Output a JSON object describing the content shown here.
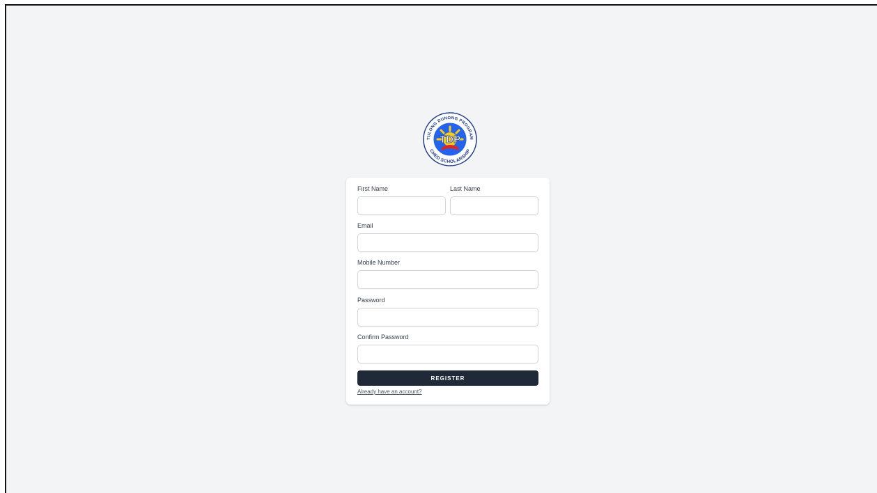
{
  "logo": {
    "text": "TDP",
    "ring_top": "TULONG DUNONG PROGRAM",
    "ring_bottom": "CHED SCHOLARSHIP",
    "colors": {
      "ring": "#1e3a8a",
      "inner": "#2563eb",
      "sun": "#facc15",
      "accent": "#dc2626"
    }
  },
  "form": {
    "first_name": {
      "label": "First Name",
      "value": ""
    },
    "last_name": {
      "label": "Last Name",
      "value": ""
    },
    "email": {
      "label": "Email",
      "value": ""
    },
    "mobile": {
      "label": "Mobile Number",
      "value": ""
    },
    "password": {
      "label": "Password",
      "value": ""
    },
    "confirm_password": {
      "label": "Confirm Password",
      "value": ""
    },
    "submit_label": "REGISTER",
    "login_link": "Already have an account?"
  },
  "colors": {
    "page_bg": "#f3f4f6",
    "card_bg": "#ffffff",
    "button_bg": "#1f2937",
    "button_text": "#ffffff",
    "label_text": "#374151"
  }
}
